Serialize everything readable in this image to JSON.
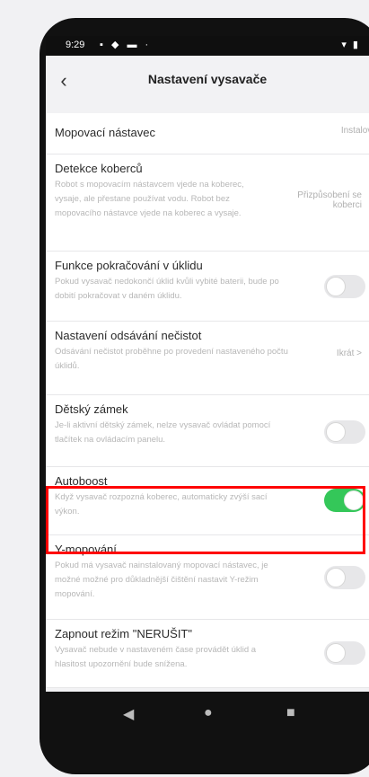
{
  "status": {
    "time": "9:29",
    "left_icons": "▪ ◆ ▬ ·",
    "right_icons": "▾ ▮"
  },
  "header": {
    "title": "Nastavení vysavače",
    "back_icon": "chevron-left-icon"
  },
  "items": [
    {
      "title": "Mopovací nástavec",
      "desc": "",
      "value": "Instalováno"
    },
    {
      "title": "Detekce koberců",
      "desc": "Robot s mopovacím nástavcem vjede na koberec, vysaje, ale přestane používat vodu. Robot bez mopovacího nástavce vjede na koberec a vysaje.",
      "value": "Přizpůsobení se koberci"
    },
    {
      "title": "Funkce pokračování v úklidu",
      "desc": "Pokud vysavač nedokončí úklid kvůli vybité baterii, bude po dobití pokračovat v daném úklidu.",
      "toggle": false
    },
    {
      "title": "Nastavení odsávání nečistot",
      "desc": "Odsávání nečistot proběhne po provedení nastaveného počtu úklidů.",
      "value": "Ikrát >"
    },
    {
      "title": "Dětský zámek",
      "desc": "Je-li aktivní dětský zámek, nelze vysavač ovládat pomocí tlačítek na ovládacím panelu.",
      "toggle": false
    },
    {
      "title": "Autoboost",
      "desc": "Když vysavač rozpozná koberec, automaticky zvýší sací výkon.",
      "toggle": true
    },
    {
      "title": "Y-mopování",
      "desc": "Pokud má vysavač nainstalovaný mopovací nástavec, je možné možné pro důkladnější čištění nastavit Y-režim mopování.",
      "toggle": false
    },
    {
      "title": "Zapnout režim \"NERUŠIT\"",
      "desc": "Vysavač nebude v nastaveném čase provádět úklid a hlasitost upozornění bude snížena.",
      "toggle": false
    }
  ],
  "nav": {
    "back": "◀",
    "home": "●",
    "recents": "■"
  },
  "colors": {
    "toggle_on": "#34c759",
    "highlight": "#ff0000"
  }
}
